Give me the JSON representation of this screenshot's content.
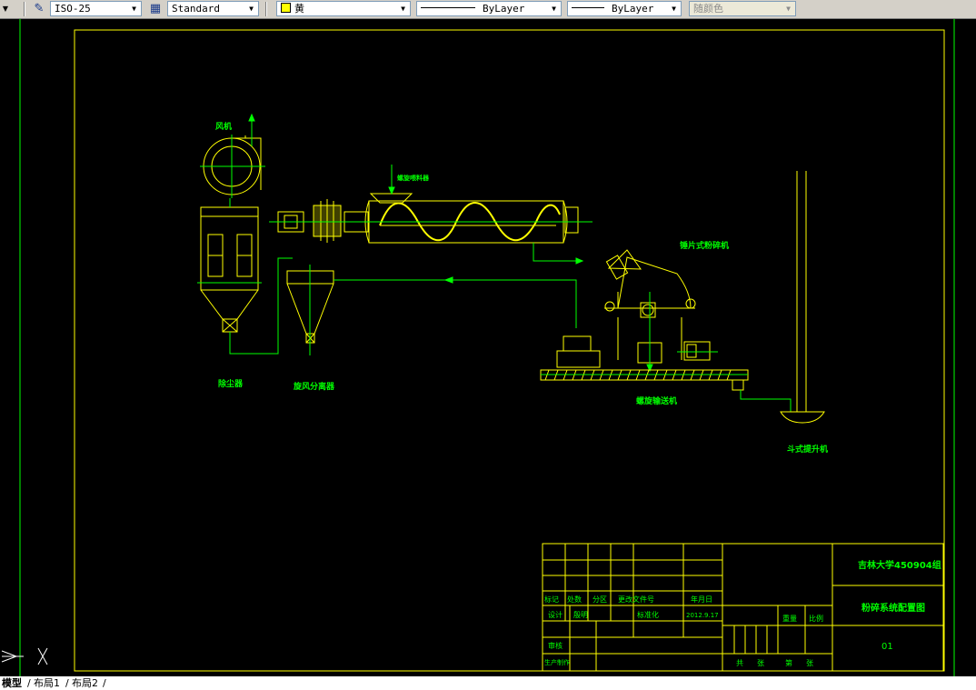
{
  "toolbar": {
    "dimstyle": "ISO-25",
    "textstyle": "Standard",
    "layer": "黄",
    "linetype": "ByLayer",
    "lineweight": "ByLayer",
    "plotstyle": "随颜色"
  },
  "drawing": {
    "labels": {
      "fan": "风机",
      "dust_collector": "除尘器",
      "cyclone": "旋风分离器",
      "feeder": "螺旋喂料器",
      "hammer_mill": "锤片式粉碎机",
      "screw_conveyor": "螺旋输送机",
      "bucket_elevator": "斗式提升机"
    },
    "title_block": {
      "school": "吉林大学450904组",
      "drawing_name": "粉碎系统配置图",
      "number": "01",
      "marks": "标记",
      "count": "处数",
      "zone": "分区",
      "change_doc": "更改文件号",
      "date_hdr": "年月日",
      "design": "设计",
      "designer": "殷明",
      "standardize": "标准化",
      "date": "2012.9.17",
      "weight": "重量",
      "scale": "比例",
      "review": "审核",
      "process": "生产制作",
      "total": "共",
      "sheets": "张",
      "sheet_no": "第",
      "sheets2": "张"
    }
  },
  "tabs": [
    "模型",
    "布局1",
    "布局2"
  ],
  "colors": {
    "frame": "#ffff00",
    "green": "#00ff00",
    "white": "#ffffff"
  }
}
